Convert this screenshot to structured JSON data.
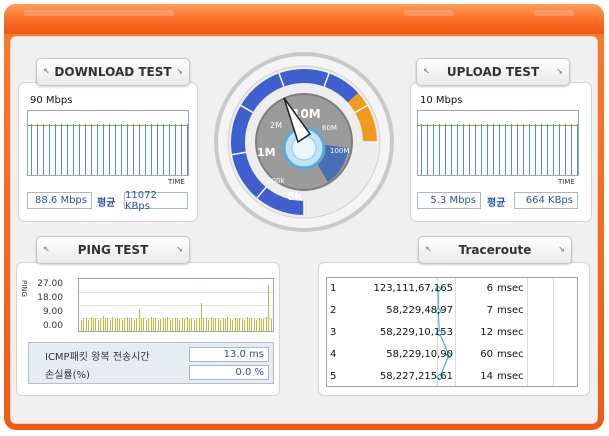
{
  "download": {
    "tab_label": "DOWNLOAD TEST",
    "scale": "90 Mbps",
    "time_label": "TIME",
    "speed_mbps": "88.6 Mbps",
    "avg_label": "평균",
    "speed_kbps": "11072 KBps"
  },
  "upload": {
    "tab_label": "UPLOAD TEST",
    "scale": "10 Mbps",
    "time_label": "TIME",
    "speed_mbps": "5.3 Mbps",
    "avg_label": "평균",
    "speed_kbps": "664 KBps"
  },
  "gauge": {
    "labels": [
      "0k",
      "500k",
      "1M",
      "2M",
      "10M",
      "60M",
      "100M"
    ],
    "colors": {
      "blue": "#3f5fcf",
      "orange": "#f29a1f",
      "face": "#9b9b9b"
    }
  },
  "ping": {
    "tab_label": "PING TEST",
    "axis_label": "PING",
    "y_ticks": [
      "27.00",
      "18.00",
      "9.00",
      "0.00"
    ],
    "icmp_label": "ICMP패킷 왕복 전송시간",
    "loss_label": "손실률(%)",
    "rtt_value": "13.0 ms",
    "loss_value": "0.0 %"
  },
  "traceroute": {
    "tab_label": "Traceroute",
    "unit": "msec",
    "hops": [
      {
        "no": "1",
        "ip": "123,111,67,165",
        "ms": "6"
      },
      {
        "no": "2",
        "ip": "58,229,48,97",
        "ms": "7"
      },
      {
        "no": "3",
        "ip": "58,229,10,153",
        "ms": "12"
      },
      {
        "no": "4",
        "ip": "58,229,10,90",
        "ms": "60"
      },
      {
        "no": "5",
        "ip": "58,227,215,61",
        "ms": "14"
      }
    ]
  }
}
